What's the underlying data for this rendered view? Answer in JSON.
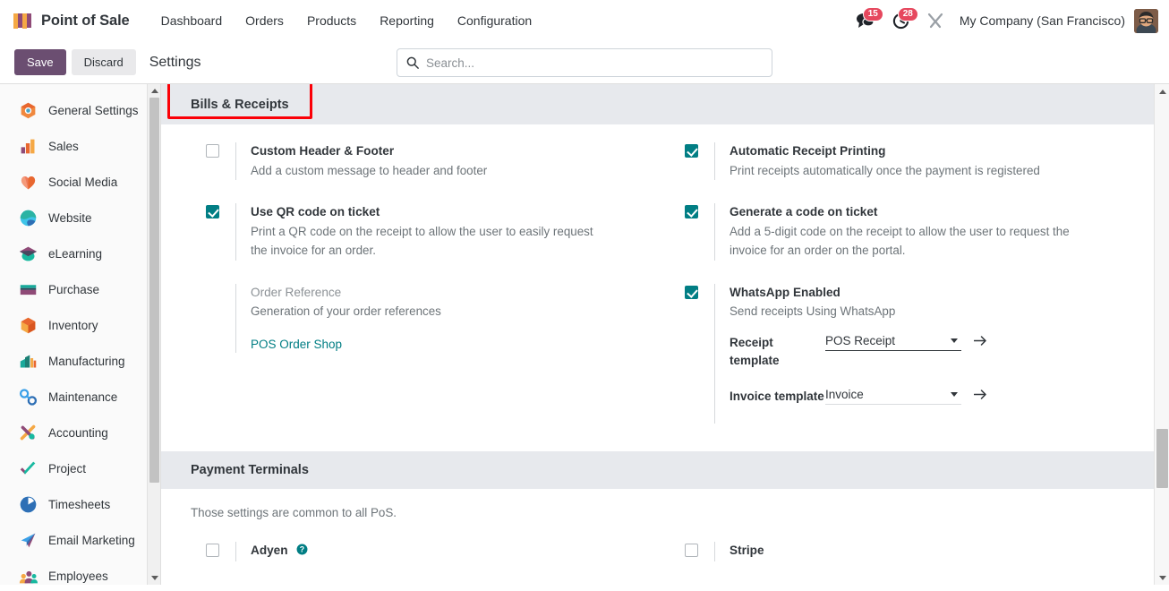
{
  "navbar": {
    "brand": "Point of Sale",
    "brand_icon": "pos-awning-icon",
    "links": [
      "Dashboard",
      "Orders",
      "Products",
      "Reporting",
      "Configuration"
    ],
    "messages_icon": "chat-bubble-icon",
    "messages_count": "15",
    "activities_icon": "clock-icon",
    "activities_count": "28",
    "debug_icon": "wrench-tools-icon",
    "company": "My Company (San Francisco)",
    "avatar_icon": "user-avatar"
  },
  "control_panel": {
    "save_label": "Save",
    "discard_label": "Discard",
    "title": "Settings",
    "search_placeholder": "Search...",
    "search_value": "",
    "search_icon": "search-icon"
  },
  "sidebar": {
    "items": [
      {
        "label": "General Settings",
        "icon": "general-settings-icon"
      },
      {
        "label": "Sales",
        "icon": "sales-icon"
      },
      {
        "label": "Social Media",
        "icon": "social-media-icon"
      },
      {
        "label": "Website",
        "icon": "website-icon"
      },
      {
        "label": "eLearning",
        "icon": "elearning-icon"
      },
      {
        "label": "Purchase",
        "icon": "purchase-icon"
      },
      {
        "label": "Inventory",
        "icon": "inventory-icon"
      },
      {
        "label": "Manufacturing",
        "icon": "manufacturing-icon"
      },
      {
        "label": "Maintenance",
        "icon": "maintenance-icon"
      },
      {
        "label": "Accounting",
        "icon": "accounting-icon"
      },
      {
        "label": "Project",
        "icon": "project-icon"
      },
      {
        "label": "Timesheets",
        "icon": "timesheets-icon"
      },
      {
        "label": "Email Marketing",
        "icon": "email-marketing-icon"
      },
      {
        "label": "Employees",
        "icon": "employees-icon"
      }
    ]
  },
  "bills_receipts": {
    "section_title": "Bills & Receipts",
    "annotation_color": "#fb0007",
    "custom_header_footer": {
      "label": "Custom Header & Footer",
      "desc": "Add a custom message to header and footer",
      "checked": false
    },
    "automatic_receipt_printing": {
      "label": "Automatic Receipt Printing",
      "desc": "Print receipts automatically once the payment is registered",
      "checked": true
    },
    "qr_code": {
      "label": "Use QR code on ticket",
      "desc": "Print a QR code on the receipt to allow the user to easily request the invoice for an order.",
      "checked": true
    },
    "generate_code": {
      "label": "Generate a code on ticket",
      "desc": "Add a 5-digit code on the receipt to allow the user to request the invoice for an order on the portal.",
      "checked": true
    },
    "order_reference": {
      "label": "Order Reference",
      "desc": "Generation of your order references",
      "link": "POS Order Shop"
    },
    "whatsapp": {
      "label": "WhatsApp Enabled",
      "desc": "Send receipts Using WhatsApp",
      "checked": true,
      "receipt_template_label": "Receipt template",
      "receipt_template_value": "POS Receipt",
      "invoice_template_label": "Invoice template",
      "invoice_template_value": "Invoice",
      "internal_link_icon": "arrow-right-icon",
      "dropdown_icon": "chevron-down-icon"
    }
  },
  "payment_terminals": {
    "section_title": "Payment Terminals",
    "note": "Those settings are common to all PoS.",
    "adyen": {
      "label": "Adyen",
      "checked": false,
      "help_icon": "question-mark-icon"
    },
    "stripe": {
      "label": "Stripe",
      "checked": false
    }
  },
  "colors": {
    "accent_teal": "#017e84",
    "save_purple": "#6b4e71",
    "badge_red": "#e6485e",
    "annotation_red": "#fb0007",
    "section_bg": "#e7e9ed"
  }
}
